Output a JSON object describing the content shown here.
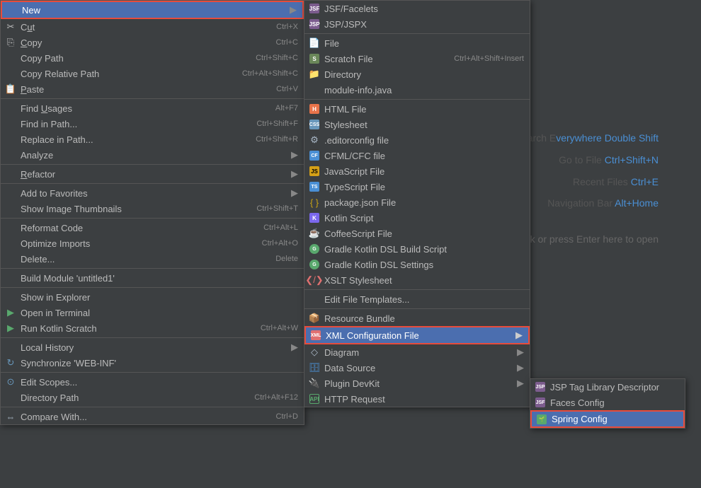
{
  "background": {
    "hints": [
      {
        "label": "Search E",
        "suffix": "verywhere",
        "shortcut": "Double Shift"
      },
      {
        "label": "Go to File  ",
        "shortcut": "Ctrl+Shift+N"
      },
      {
        "label": "Recent Files  ",
        "shortcut": "Ctrl+E"
      },
      {
        "label": "Navigation Bar ",
        "shortcut": "Alt+Home"
      }
    ],
    "open_hint": "Double-click or press Enter here to open"
  },
  "main_menu": {
    "items": [
      {
        "id": "new",
        "label": "New",
        "shortcut": "",
        "has_arrow": true,
        "selected": true,
        "icon": "arrow-right"
      },
      {
        "id": "cut",
        "label": "Cut",
        "shortcut": "Ctrl+X",
        "icon": "scissors"
      },
      {
        "id": "copy",
        "label": "Copy",
        "shortcut": "Ctrl+C",
        "icon": "copy"
      },
      {
        "id": "copy-path",
        "label": "Copy Path",
        "shortcut": "Ctrl+Shift+C"
      },
      {
        "id": "copy-rel",
        "label": "Copy Relative Path",
        "shortcut": "Ctrl+Alt+Shift+C"
      },
      {
        "id": "paste",
        "label": "Paste",
        "shortcut": "Ctrl+V",
        "icon": "paste"
      },
      {
        "separator": true
      },
      {
        "id": "find-usages",
        "label": "Find Usages",
        "shortcut": "Alt+F7"
      },
      {
        "id": "find-in-path",
        "label": "Find in Path...",
        "shortcut": "Ctrl+Shift+F"
      },
      {
        "id": "replace-in-path",
        "label": "Replace in Path...",
        "shortcut": "Ctrl+Shift+R"
      },
      {
        "id": "analyze",
        "label": "Analyze",
        "shortcut": "",
        "has_arrow": true
      },
      {
        "separator": true
      },
      {
        "id": "refactor",
        "label": "Refactor",
        "shortcut": "",
        "has_arrow": true
      },
      {
        "separator": true
      },
      {
        "id": "add-favorites",
        "label": "Add to Favorites",
        "shortcut": "",
        "has_arrow": true
      },
      {
        "id": "show-thumbnails",
        "label": "Show Image Thumbnails",
        "shortcut": "Ctrl+Shift+T"
      },
      {
        "separator": true
      },
      {
        "id": "reformat",
        "label": "Reformat Code",
        "shortcut": "Ctrl+Alt+L"
      },
      {
        "id": "optimize",
        "label": "Optimize Imports",
        "shortcut": "Ctrl+Alt+O"
      },
      {
        "id": "delete",
        "label": "Delete...",
        "shortcut": "Delete"
      },
      {
        "separator": true
      },
      {
        "id": "build-module",
        "label": "Build Module 'untitled1'"
      },
      {
        "separator": true
      },
      {
        "id": "show-explorer",
        "label": "Show in Explorer"
      },
      {
        "id": "open-terminal",
        "label": "Open in Terminal",
        "icon": "terminal"
      },
      {
        "id": "run-kotlin",
        "label": "Run Kotlin Scratch",
        "shortcut": "Ctrl+Alt+W",
        "icon": "run"
      },
      {
        "separator": true
      },
      {
        "id": "local-history",
        "label": "Local History",
        "has_arrow": true
      },
      {
        "id": "synchronize",
        "label": "Synchronize 'WEB-INF'",
        "icon": "sync"
      },
      {
        "separator": true
      },
      {
        "id": "edit-scopes",
        "label": "Edit Scopes...",
        "icon": "edit"
      },
      {
        "id": "directory-path",
        "label": "Directory Path",
        "shortcut": "Ctrl+Alt+F12"
      },
      {
        "separator": true
      },
      {
        "id": "compare-with",
        "label": "Compare With...",
        "shortcut": "Ctrl+D",
        "icon": "compare"
      }
    ]
  },
  "submenu1": {
    "items": [
      {
        "id": "jsf",
        "label": "JSF/Facelets",
        "icon": "jsp"
      },
      {
        "id": "jsp",
        "label": "JSP/JSPX",
        "icon": "jsp"
      },
      {
        "separator": true
      },
      {
        "id": "file",
        "label": "File",
        "icon": "file"
      },
      {
        "id": "scratch",
        "label": "Scratch File",
        "shortcut": "Ctrl+Alt+Shift+Insert",
        "icon": "scratch",
        "selected": false
      },
      {
        "id": "directory",
        "label": "Directory",
        "icon": "dir"
      },
      {
        "id": "module-info",
        "label": "module-info.java",
        "disabled": true
      },
      {
        "separator": true
      },
      {
        "id": "html",
        "label": "HTML File",
        "icon": "html"
      },
      {
        "id": "stylesheet",
        "label": "Stylesheet",
        "icon": "css"
      },
      {
        "id": "editorconfig",
        "label": ".editorconfig file",
        "icon": "edcfg"
      },
      {
        "id": "cfml",
        "label": "CFML/CFC file",
        "icon": "cfml"
      },
      {
        "id": "javascript",
        "label": "JavaScript File",
        "icon": "js"
      },
      {
        "id": "typescript",
        "label": "TypeScript File",
        "icon": "ts"
      },
      {
        "id": "packagejson",
        "label": "package.json File",
        "icon": "pkg"
      },
      {
        "id": "kotlin",
        "label": "Kotlin Script",
        "icon": "kt"
      },
      {
        "id": "coffeescript",
        "label": "CoffeeScript File",
        "icon": "coffee"
      },
      {
        "id": "gradle-dsl",
        "label": "Gradle Kotlin DSL Build Script",
        "icon": "gradle"
      },
      {
        "id": "gradle-settings",
        "label": "Gradle Kotlin DSL Settings",
        "icon": "gradle"
      },
      {
        "id": "xslt",
        "label": "XSLT Stylesheet",
        "icon": "xslt"
      },
      {
        "separator": true
      },
      {
        "id": "edit-templates",
        "label": "Edit File Templates..."
      },
      {
        "separator": true
      },
      {
        "id": "resource-bundle",
        "label": "Resource Bundle",
        "icon": "bundle"
      },
      {
        "id": "xml-config",
        "label": "XML Configuration File",
        "icon": "xml",
        "selected": true,
        "has_arrow": true
      },
      {
        "id": "diagram",
        "label": "Diagram",
        "icon": "diagram",
        "has_arrow": true
      },
      {
        "id": "data-source",
        "label": "Data Source",
        "icon": "db",
        "has_arrow": true
      },
      {
        "id": "plugin-devkit",
        "label": "Plugin DevKit",
        "icon": "plug",
        "has_arrow": true
      },
      {
        "id": "http-request",
        "label": "HTTP Request",
        "icon": "http"
      }
    ]
  },
  "submenu2": {
    "items": [
      {
        "id": "jsp-lib",
        "label": "JSP Tag Library Descriptor",
        "icon": "jsplib"
      },
      {
        "id": "faces-config",
        "label": "Faces Config",
        "icon": "faces"
      },
      {
        "id": "spring-config",
        "label": "Spring Config",
        "icon": "spring",
        "selected": true
      }
    ]
  }
}
